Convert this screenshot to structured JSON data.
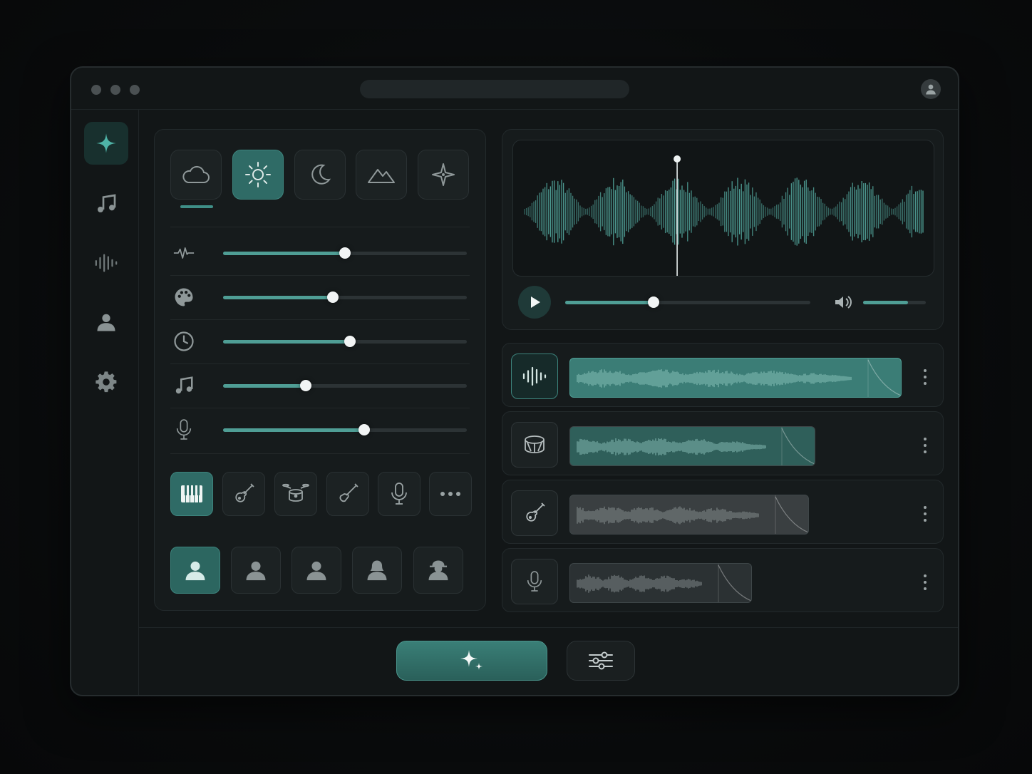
{
  "window": {
    "traffic_lights": [
      "close",
      "minimize",
      "maximize"
    ],
    "address_bar_text": "",
    "profile_icon": "user-icon"
  },
  "sidebar": {
    "items": [
      {
        "icon": "sparkle-icon",
        "active": true
      },
      {
        "icon": "music-note-icon",
        "active": false
      },
      {
        "icon": "audio-bars-icon",
        "active": false
      },
      {
        "icon": "user-icon",
        "active": false
      },
      {
        "icon": "gear-icon",
        "active": false
      }
    ]
  },
  "moods": [
    {
      "icon": "cloud-icon",
      "active": false
    },
    {
      "icon": "sun-icon",
      "active": true
    },
    {
      "icon": "moon-icon",
      "active": false
    },
    {
      "icon": "mountain-icon",
      "active": false
    },
    {
      "icon": "star-icon",
      "active": false
    }
  ],
  "sliders": [
    {
      "icon": "pulse-icon",
      "value": 0.5
    },
    {
      "icon": "palette-icon",
      "value": 0.45
    },
    {
      "icon": "clock-icon",
      "value": 0.52
    },
    {
      "icon": "music-note-icon",
      "value": 0.34
    },
    {
      "icon": "microphone-icon",
      "value": 0.58
    }
  ],
  "instruments": [
    {
      "icon": "piano-icon",
      "active": true
    },
    {
      "icon": "acoustic-guitar-icon",
      "active": false
    },
    {
      "icon": "drum-kit-icon",
      "active": false
    },
    {
      "icon": "electric-guitar-icon",
      "active": false
    },
    {
      "icon": "microphone-icon",
      "active": false
    },
    {
      "icon": "more-icon",
      "active": false
    }
  ],
  "voices": [
    {
      "icon": "voice-male-icon",
      "active": true
    },
    {
      "icon": "voice-person-icon",
      "active": false
    },
    {
      "icon": "voice-person-icon",
      "active": false
    },
    {
      "icon": "voice-female-icon",
      "active": false
    },
    {
      "icon": "voice-hat-icon",
      "active": false
    }
  ],
  "player": {
    "playhead_position": 0.39,
    "progress": 0.36,
    "volume": 0.72,
    "play_icon": "play-icon",
    "volume_icon": "speaker-icon"
  },
  "tracks": [
    {
      "icon": "audio-bars-icon",
      "clip_length": 1.0,
      "active": true,
      "color": "#3b7d76"
    },
    {
      "icon": "drum-icon",
      "clip_length": 0.74,
      "active": false,
      "color": "#2f5f5a"
    },
    {
      "icon": "guitar-icon",
      "clip_length": 0.72,
      "active": false,
      "color": "#3a3f41"
    },
    {
      "icon": "microphone-icon",
      "clip_length": 0.55,
      "active": false,
      "color": "#2b3133"
    }
  ],
  "footer": {
    "generate_icon": "sparkle-icon",
    "settings_icon": "sliders-icon"
  },
  "colors": {
    "accent": "#3f8f87",
    "accent_dark": "#2f6b66",
    "background": "#0a0c0d",
    "panel": "#161b1c"
  }
}
